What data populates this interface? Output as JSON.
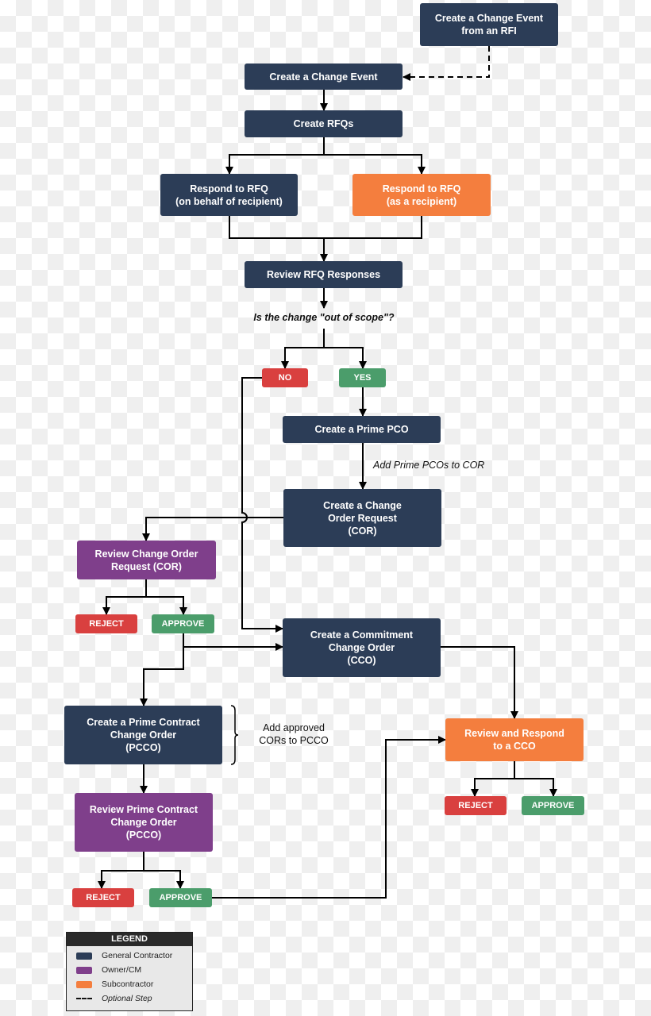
{
  "colors": {
    "general_contractor": "#2c3d57",
    "owner_cm": "#7f3f8b",
    "subcontractor": "#f47e3e",
    "reject": "#d9403f",
    "approve": "#4b9d6b"
  },
  "nodes": {
    "rfi": "Create a Change Event\nfrom an RFI",
    "change_event": "Create a Change Event",
    "rfqs": "Create RFQs",
    "respond_behalf": "Respond to RFQ\n(on behalf of recipient)",
    "respond_recipient": "Respond to RFQ\n(as a recipient)",
    "review_rfq": "Review RFQ Responses",
    "question": "Is the change \"out of scope\"?",
    "no": "NO",
    "yes": "YES",
    "prime_pco": "Create a Prime PCO",
    "add_pcos_note": "Add Prime PCOs to COR",
    "cor": "Create a Change\nOrder Request\n(COR)",
    "review_cor": "Review Change Order\nRequest (COR)",
    "reject_cor": "REJECT",
    "approve_cor": "APPROVE",
    "cco": "Create a Commitment\nChange Order\n(CCO)",
    "pcco": "Create a Prime Contract\nChange Order\n(PCCO)",
    "add_cors_note": "Add approved\nCORs to PCCO",
    "review_pcco": "Review Prime Contract\nChange Order\n(PCCO)",
    "reject_pcco": "REJECT",
    "approve_pcco": "APPROVE",
    "review_cco": "Review and Respond\nto a CCO",
    "reject_cco": "REJECT",
    "approve_cco": "APPROVE"
  },
  "legend": {
    "title": "LEGEND",
    "items": [
      "General Contractor",
      "Owner/CM",
      "Subcontractor",
      "Optional Step"
    ]
  }
}
